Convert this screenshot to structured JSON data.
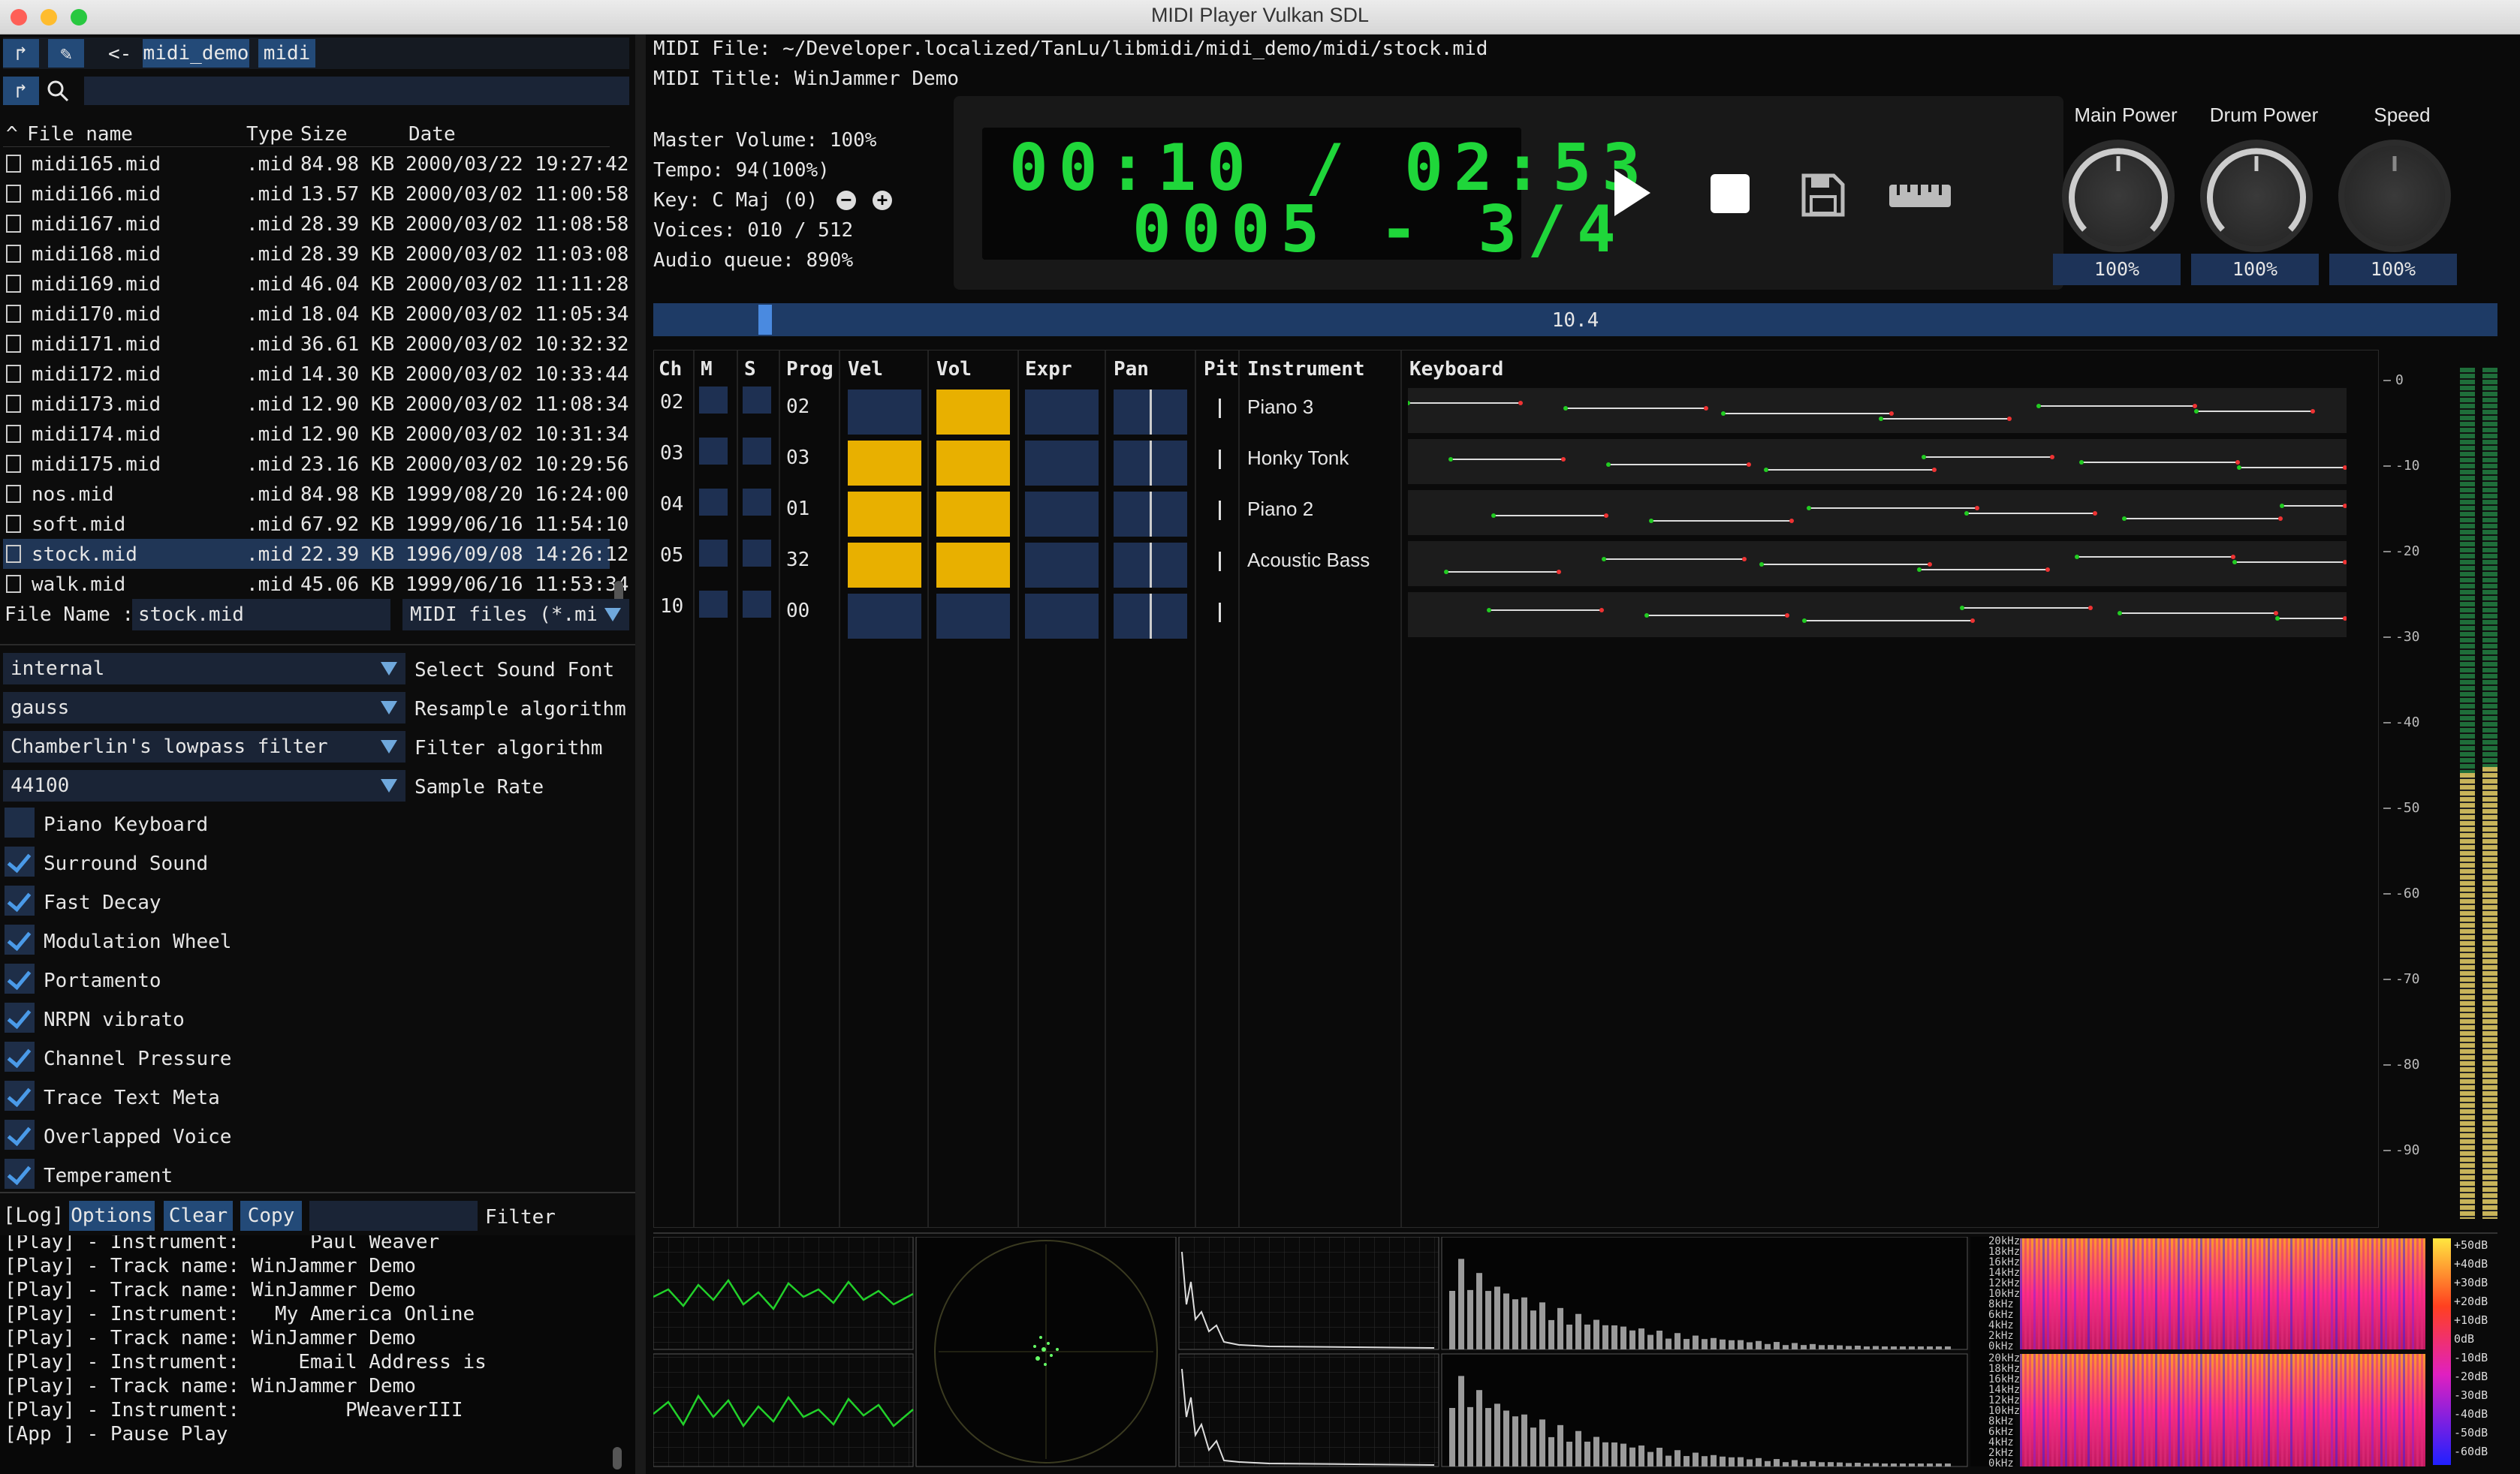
{
  "window": {
    "title": "MIDI Player Vulkan SDL"
  },
  "browser": {
    "path": [
      "<-",
      "midi_demo",
      "midi"
    ],
    "headers": {
      "name": "File name",
      "type": "Type",
      "size": "Size",
      "date": "Date"
    },
    "files": [
      {
        "name": "midi165.mid",
        "type": ".mid",
        "size": "84.98 KB",
        "date": "2000/03/22 19:27:42"
      },
      {
        "name": "midi166.mid",
        "type": ".mid",
        "size": "13.57 KB",
        "date": "2000/03/02 11:00:58"
      },
      {
        "name": "midi167.mid",
        "type": ".mid",
        "size": "28.39 KB",
        "date": "2000/03/02 11:08:58"
      },
      {
        "name": "midi168.mid",
        "type": ".mid",
        "size": "28.39 KB",
        "date": "2000/03/02 11:03:08"
      },
      {
        "name": "midi169.mid",
        "type": ".mid",
        "size": "46.04 KB",
        "date": "2000/03/02 11:11:28"
      },
      {
        "name": "midi170.mid",
        "type": ".mid",
        "size": "18.04 KB",
        "date": "2000/03/02 11:05:34"
      },
      {
        "name": "midi171.mid",
        "type": ".mid",
        "size": "36.61 KB",
        "date": "2000/03/02 10:32:32"
      },
      {
        "name": "midi172.mid",
        "type": ".mid",
        "size": "14.30 KB",
        "date": "2000/03/02 10:33:44"
      },
      {
        "name": "midi173.mid",
        "type": ".mid",
        "size": "12.90 KB",
        "date": "2000/03/02 11:08:34"
      },
      {
        "name": "midi174.mid",
        "type": ".mid",
        "size": "12.90 KB",
        "date": "2000/03/02 10:31:34"
      },
      {
        "name": "midi175.mid",
        "type": ".mid",
        "size": "23.16 KB",
        "date": "2000/03/02 10:29:56"
      },
      {
        "name": "nos.mid",
        "type": ".mid",
        "size": "84.98 KB",
        "date": "1999/08/20 16:24:00"
      },
      {
        "name": "soft.mid",
        "type": ".mid",
        "size": "67.92 KB",
        "date": "1999/06/16 11:54:10"
      },
      {
        "name": "stock.mid",
        "type": ".mid",
        "size": "22.39 KB",
        "date": "1996/09/08 14:26:12",
        "selected": true
      },
      {
        "name": "walk.mid",
        "type": ".mid",
        "size": "45.06 KB",
        "date": "1999/06/16 11:53:34"
      }
    ],
    "file_name_label": "File Name :",
    "file_name_value": "stock.mid",
    "filter_value": "MIDI files (*.mid"
  },
  "settings": {
    "combos": [
      {
        "value": "internal",
        "label": "Select Sound Font"
      },
      {
        "value": "gauss",
        "label": "Resample algorithm"
      },
      {
        "value": "Chamberlin's lowpass filter",
        "label": "Filter algorithm"
      },
      {
        "value": "44100",
        "label": "Sample Rate"
      }
    ],
    "checks": [
      {
        "label": "Piano Keyboard",
        "on": false
      },
      {
        "label": "Surround Sound",
        "on": true
      },
      {
        "label": "Fast Decay",
        "on": true
      },
      {
        "label": "Modulation Wheel",
        "on": true
      },
      {
        "label": "Portamento",
        "on": true
      },
      {
        "label": "NRPN vibrato",
        "on": true
      },
      {
        "label": "Channel Pressure",
        "on": true
      },
      {
        "label": "Trace Text Meta",
        "on": true
      },
      {
        "label": "Overlapped Voice",
        "on": true
      },
      {
        "label": "Temperament",
        "on": true
      }
    ]
  },
  "log": {
    "title": "[Log]",
    "buttons": [
      "Options",
      "Clear",
      "Copy"
    ],
    "filter_label": "Filter",
    "lines": [
      "[Play] - Instrument:      Paul Weaver",
      "[Play] - Track name: WinJammer Demo",
      "[Play] - Track name: WinJammer Demo",
      "[Play] - Instrument:   My America Online",
      "[Play] - Track name: WinJammer Demo",
      "[Play] - Instrument:     Email Address is",
      "[Play] - Track name: WinJammer Demo",
      "[Play] - Instrument:         PWeaverIII",
      "[App ] - Pause Play"
    ]
  },
  "info": {
    "file": "MIDI File: ~/Developer.localized/TanLu/libmidi/midi_demo/midi/stock.mid",
    "title": "MIDI Title: WinJammer Demo",
    "master_volume": "Master Volume: 100%",
    "tempo": "Tempo: 94(100%)",
    "key": "Key: C  Maj (0)",
    "voices": "Voices: 010 / 512",
    "audio_queue": "Audio queue: 890%"
  },
  "lcd": {
    "time": "00:10 / 02:53",
    "position": "0005 - 3/4"
  },
  "knobs": [
    {
      "label": "Main Power",
      "value": "100%"
    },
    {
      "label": "Drum Power",
      "value": "100%"
    },
    {
      "label": "Speed",
      "value": "100%"
    }
  ],
  "progress": {
    "value": "10.4",
    "fraction": 0.057
  },
  "channels": {
    "headers": [
      "Ch",
      "M",
      "S",
      "Prog",
      "Vel",
      "Vol",
      "Expr",
      "Pan",
      "Pit",
      "Instrument",
      "Keyboard"
    ],
    "rows": [
      {
        "ch": "02",
        "prog": "02",
        "vel": 0,
        "vol": 1,
        "instrument": "Piano 3"
      },
      {
        "ch": "03",
        "prog": "03",
        "vel": 1,
        "vol": 1,
        "instrument": "Honky Tonk"
      },
      {
        "ch": "04",
        "prog": "01",
        "vel": 1,
        "vol": 1,
        "instrument": "Piano 2"
      },
      {
        "ch": "05",
        "prog": "32",
        "vel": 1,
        "vol": 1,
        "instrument": "Acoustic Bass"
      },
      {
        "ch": "10",
        "prog": "00",
        "vel": 0,
        "vol": 0,
        "instrument": ""
      }
    ]
  },
  "meter": {
    "ticks": [
      "0",
      "-10",
      "-20",
      "-30",
      "-40",
      "-50",
      "-60",
      "-70",
      "-80",
      "-90"
    ]
  },
  "spectrum": {
    "freq_labels": [
      "20kHz",
      "18kHz",
      "16kHz",
      "14kHz",
      "12kHz",
      "10kHz",
      "8kHz",
      "6kHz",
      "4kHz",
      "2kHz",
      "0kHz"
    ],
    "db_labels": [
      "+50dB",
      "+40dB",
      "+30dB",
      "+20dB",
      "+10dB",
      "0dB",
      "-10dB",
      "-20dB",
      "-30dB",
      "-40dB",
      "-50dB",
      "-60dB"
    ]
  }
}
